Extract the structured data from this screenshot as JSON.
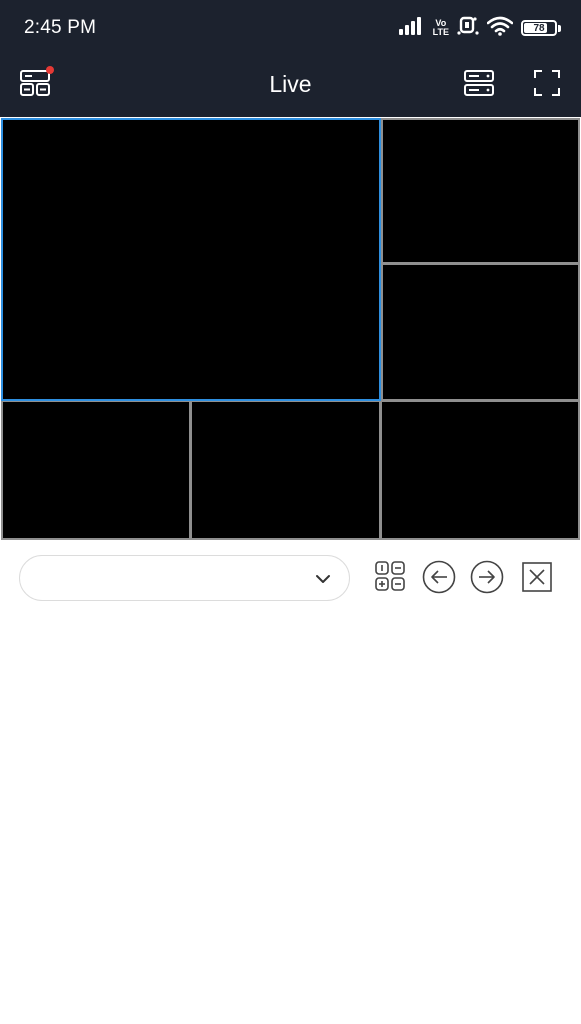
{
  "status_bar": {
    "time": "2:45 PM",
    "network_label_top": "Vo",
    "network_label_bottom": "LTE",
    "battery": "78",
    "battery_level": 0.78
  },
  "header": {
    "title": "Live",
    "left_icon": "device-list-icon",
    "notification_dot_color": "#e53935",
    "right_icons": [
      "device-server-icon",
      "fullscreen-icon"
    ]
  },
  "video_grid": {
    "layout": "6-split",
    "selected_color": "#2e8fe0",
    "tiles": [
      {
        "name": "tile-1",
        "selected": true
      },
      {
        "name": "tile-2",
        "selected": false
      },
      {
        "name": "tile-3",
        "selected": false
      },
      {
        "name": "tile-4",
        "selected": false
      },
      {
        "name": "tile-5",
        "selected": false
      },
      {
        "name": "tile-6",
        "selected": false
      }
    ]
  },
  "controls": {
    "select_value": "",
    "icons": [
      "layout-grid-icon",
      "previous-icon",
      "next-icon",
      "close-all-icon"
    ]
  }
}
